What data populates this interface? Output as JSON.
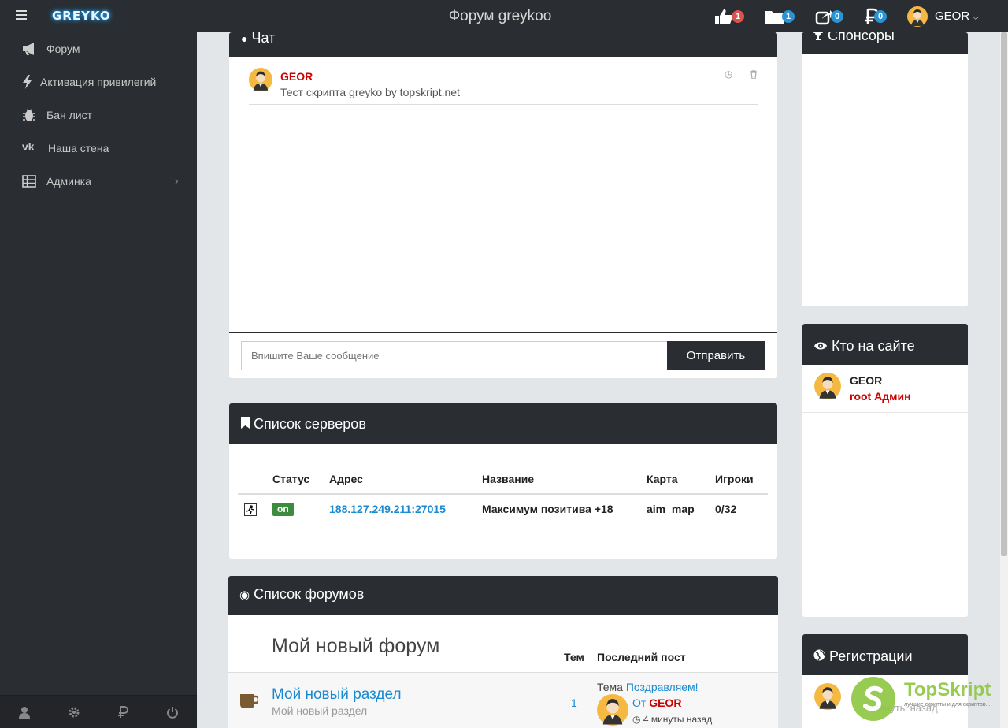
{
  "topbar": {
    "logo": "GREYKO",
    "title": "Форум greykoo",
    "likes_badge": "1",
    "folders_badge": "1",
    "share_badge": "0",
    "money_badge": "0",
    "username": "GEOR"
  },
  "sidebar": {
    "items": [
      {
        "label": "Форум",
        "icon": "megaphone-icon"
      },
      {
        "label": "Активация привилегий",
        "icon": "lightning-icon"
      },
      {
        "label": "Бан лист",
        "icon": "bug-icon"
      },
      {
        "label": "Наша стена",
        "icon": "vk-icon"
      },
      {
        "label": "Админка",
        "icon": "table-icon"
      }
    ],
    "footer_icons": [
      "user-icon",
      "gear-icon",
      "ruble-icon",
      "power-icon"
    ]
  },
  "chat": {
    "title": "Чат",
    "message": {
      "author": "GEOR",
      "text": "Тест скрипта greyko by topskript.net"
    },
    "input_placeholder": "Впишите Ваше сообщение",
    "send_label": "Отправить"
  },
  "servers": {
    "title": "Список серверов",
    "columns": [
      "Статус",
      "Адрес",
      "Название",
      "Карта",
      "Игроки"
    ],
    "rows": [
      {
        "status": "on",
        "address": "188.127.249.211:27015",
        "name": "Максимум позитива +18",
        "map": "aim_map",
        "players": "0/32"
      }
    ]
  },
  "forums": {
    "title": "Список форумов",
    "forum_title": "Мой новый форум",
    "col_topics": "Тем",
    "col_last_post": "Последний пост",
    "section": {
      "name": "Мой новый раздел",
      "desc": "Мой новый раздел",
      "topics": "1",
      "last_topic_prefix": "Тема",
      "last_topic": "Поздравляем!",
      "from_prefix": "От",
      "author": "GEOR",
      "time": "4 минуты назад"
    }
  },
  "sponsors": {
    "title": "Спонсоры"
  },
  "online": {
    "title": "Кто на сайте",
    "user": "GEOR",
    "role": "root Админ"
  },
  "registrations": {
    "title": "Регистрации",
    "obscured_text": "4 минуты назад"
  },
  "watermark": {
    "brand": "TopSkript",
    "tagline": "лучшие скрипты и для скриптов..."
  },
  "colors": {
    "dark": "#2a2d31",
    "link": "#1a8ad0",
    "user_red": "#cc0000",
    "status_green": "#3d8b3d"
  }
}
